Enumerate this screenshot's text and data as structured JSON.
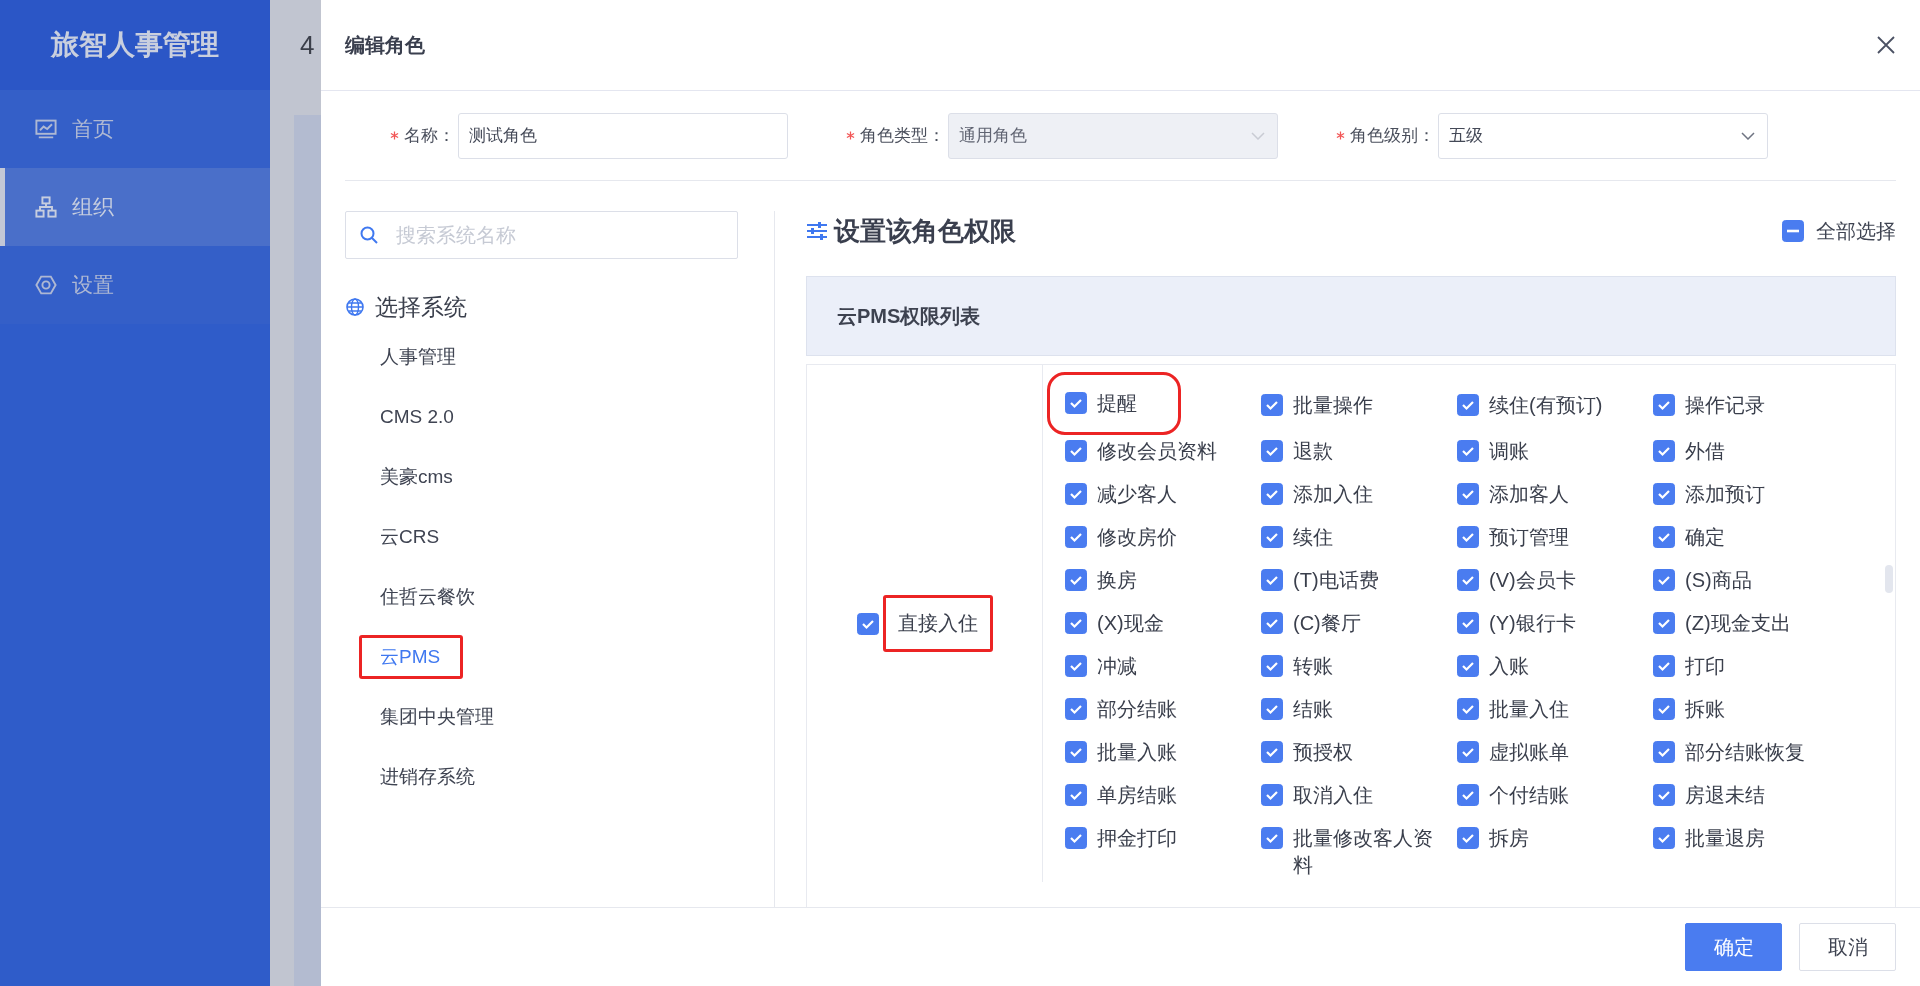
{
  "sidebar": {
    "title": "旅智人事管理",
    "items": [
      {
        "label": "首页",
        "selected": false
      },
      {
        "label": "组织",
        "selected": true
      },
      {
        "label": "设置",
        "selected": false
      }
    ]
  },
  "background_page": {
    "heading": "4"
  },
  "dialog": {
    "title": "编辑角色",
    "fields": [
      {
        "kind": "text",
        "label": "名称：",
        "required": true,
        "value": "测试角色",
        "disabled": false
      },
      {
        "kind": "select",
        "label": "角色类型：",
        "required": true,
        "value": "通用角色",
        "disabled": true
      },
      {
        "kind": "select",
        "label": "角色级别：",
        "required": true,
        "value": "五级",
        "disabled": false
      }
    ],
    "search": {
      "placeholder": "搜索系统名称"
    },
    "system_heading": "选择系统",
    "systems": [
      {
        "label": "人事管理",
        "selected": false,
        "highlighted": false
      },
      {
        "label": "CMS 2.0",
        "selected": false,
        "highlighted": false
      },
      {
        "label": "美豪cms",
        "selected": false,
        "highlighted": false
      },
      {
        "label": "云CRS",
        "selected": false,
        "highlighted": false
      },
      {
        "label": "住哲云餐饮",
        "selected": false,
        "highlighted": false
      },
      {
        "label": "云PMS",
        "selected": true,
        "highlighted": true
      },
      {
        "label": "集团中央管理",
        "selected": false,
        "highlighted": false
      },
      {
        "label": "进销存系统",
        "selected": false,
        "highlighted": false
      }
    ],
    "permissions_title": "设置该角色权限",
    "select_all": {
      "label": "全部选择",
      "indeterminate": true
    },
    "permission_table": {
      "title": "云PMS权限列表",
      "groups": [
        {
          "label": "直接入住",
          "checked": true,
          "highlighted": true,
          "items": [
            {
              "label": "提醒",
              "checked": true,
              "highlighted": true
            },
            {
              "label": "批量操作",
              "checked": true,
              "highlighted": false
            },
            {
              "label": "续住(有预订)",
              "checked": true,
              "highlighted": false
            },
            {
              "label": "操作记录",
              "checked": true,
              "highlighted": false
            },
            {
              "label": "修改会员资料",
              "checked": true,
              "highlighted": false
            },
            {
              "label": "退款",
              "checked": true,
              "highlighted": false
            },
            {
              "label": "调账",
              "checked": true,
              "highlighted": false
            },
            {
              "label": "外借",
              "checked": true,
              "highlighted": false
            },
            {
              "label": "减少客人",
              "checked": true,
              "highlighted": false
            },
            {
              "label": "添加入住",
              "checked": true,
              "highlighted": false
            },
            {
              "label": "添加客人",
              "checked": true,
              "highlighted": false
            },
            {
              "label": "添加预订",
              "checked": true,
              "highlighted": false
            },
            {
              "label": "修改房价",
              "checked": true,
              "highlighted": false
            },
            {
              "label": "续住",
              "checked": true,
              "highlighted": false
            },
            {
              "label": "预订管理",
              "checked": true,
              "highlighted": false
            },
            {
              "label": "确定",
              "checked": true,
              "highlighted": false
            },
            {
              "label": "换房",
              "checked": true,
              "highlighted": false
            },
            {
              "label": "(T)电话费",
              "checked": true,
              "highlighted": false
            },
            {
              "label": "(V)会员卡",
              "checked": true,
              "highlighted": false
            },
            {
              "label": "(S)商品",
              "checked": true,
              "highlighted": false
            },
            {
              "label": "(X)现金",
              "checked": true,
              "highlighted": false
            },
            {
              "label": "(C)餐厅",
              "checked": true,
              "highlighted": false
            },
            {
              "label": "(Y)银行卡",
              "checked": true,
              "highlighted": false
            },
            {
              "label": "(Z)现金支出",
              "checked": true,
              "highlighted": false
            },
            {
              "label": "冲减",
              "checked": true,
              "highlighted": false
            },
            {
              "label": "转账",
              "checked": true,
              "highlighted": false
            },
            {
              "label": "入账",
              "checked": true,
              "highlighted": false
            },
            {
              "label": "打印",
              "checked": true,
              "highlighted": false
            },
            {
              "label": "部分结账",
              "checked": true,
              "highlighted": false
            },
            {
              "label": "结账",
              "checked": true,
              "highlighted": false
            },
            {
              "label": "批量入住",
              "checked": true,
              "highlighted": false
            },
            {
              "label": "拆账",
              "checked": true,
              "highlighted": false
            },
            {
              "label": "批量入账",
              "checked": true,
              "highlighted": false
            },
            {
              "label": "预授权",
              "checked": true,
              "highlighted": false
            },
            {
              "label": "虚拟账单",
              "checked": true,
              "highlighted": false
            },
            {
              "label": "部分结账恢复",
              "checked": true,
              "highlighted": false
            },
            {
              "label": "单房结账",
              "checked": true,
              "highlighted": false
            },
            {
              "label": "取消入住",
              "checked": true,
              "highlighted": false
            },
            {
              "label": "个付结账",
              "checked": true,
              "highlighted": false
            },
            {
              "label": "房退未结",
              "checked": true,
              "highlighted": false
            },
            {
              "label": "押金打印",
              "checked": true,
              "highlighted": false
            },
            {
              "label": "批量修改客人资料",
              "checked": true,
              "highlighted": false
            },
            {
              "label": "拆房",
              "checked": true,
              "highlighted": false
            },
            {
              "label": "批量退房",
              "checked": true,
              "highlighted": false
            }
          ]
        }
      ]
    },
    "buttons": [
      {
        "label": "确定",
        "kind": "primary"
      },
      {
        "label": "取消",
        "kind": "default"
      }
    ]
  }
}
